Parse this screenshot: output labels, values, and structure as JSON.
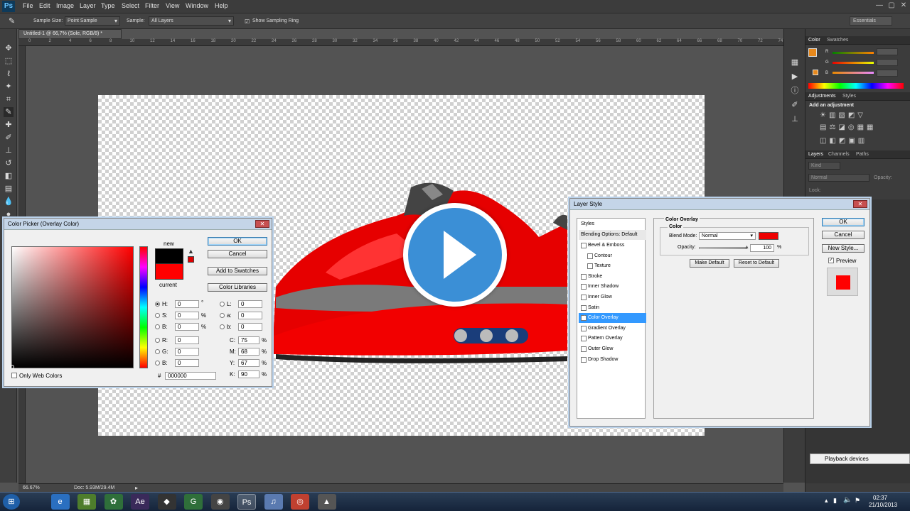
{
  "app": {
    "logo": "Ps",
    "accent": "#3b8fd6"
  },
  "menu": [
    "File",
    "Edit",
    "Image",
    "Layer",
    "Type",
    "Select",
    "Filter",
    "View",
    "Window",
    "Help"
  ],
  "window_controls": [
    "—",
    "▢",
    "✕"
  ],
  "options": {
    "sample_size_label": "Sample Size:",
    "sample_size_value": "Point Sample",
    "sample_label": "Sample:",
    "sample_value": "All Layers",
    "show_ring_label": "Show Sampling Ring",
    "workspace": "Essentials"
  },
  "document": {
    "tab_title": "Untitled-1 @ 66,7% (Sole, RGB/8) *",
    "zoom": "66.67%",
    "doc_size": "Doc: 5.93M/29.4M",
    "ruler_marks": [
      "0",
      "2",
      "4",
      "6",
      "8",
      "10",
      "12",
      "14",
      "16",
      "18",
      "20",
      "22",
      "24",
      "26",
      "28",
      "30",
      "32",
      "34",
      "36",
      "38",
      "40",
      "42",
      "44",
      "46",
      "48",
      "50",
      "52",
      "54",
      "56",
      "58",
      "60",
      "62",
      "64",
      "66",
      "68",
      "70",
      "72",
      "74"
    ]
  },
  "color_picker": {
    "title": "Color Picker (Overlay Color)",
    "new_label": "new",
    "current_label": "current",
    "new_color": "#000000",
    "current_color": "#ff0000",
    "ok": "OK",
    "cancel": "Cancel",
    "add_swatches": "Add to Swatches",
    "color_libraries": "Color Libraries",
    "only_web": "Only Web Colors",
    "fields": {
      "H": "0",
      "S": "0",
      "B": "0",
      "R": "0",
      "G": "0",
      "Bv": "0",
      "L": "0",
      "a": "0",
      "b": "0",
      "C": "75",
      "M": "68",
      "Y": "67",
      "K": "90",
      "hex": "000000"
    },
    "labels": {
      "H": "H:",
      "S": "S:",
      "B": "B:",
      "R": "R:",
      "G": "G:",
      "Bv": "B:",
      "L": "L:",
      "a": "a:",
      "b": "b:",
      "C": "C:",
      "M": "M:",
      "Y": "Y:",
      "K": "K:",
      "hex": "#",
      "deg": "°",
      "pct": "%"
    }
  },
  "layer_style": {
    "title": "Layer Style",
    "styles_header": "Styles",
    "blending": "Blending Options: Default",
    "items": [
      {
        "label": "Bevel & Emboss",
        "checked": false,
        "indent": false
      },
      {
        "label": "Contour",
        "checked": false,
        "indent": true
      },
      {
        "label": "Texture",
        "checked": false,
        "indent": true
      },
      {
        "label": "Stroke",
        "checked": false,
        "indent": false
      },
      {
        "label": "Inner Shadow",
        "checked": false,
        "indent": false
      },
      {
        "label": "Inner Glow",
        "checked": false,
        "indent": false
      },
      {
        "label": "Satin",
        "checked": false,
        "indent": false
      },
      {
        "label": "Color Overlay",
        "checked": true,
        "indent": false
      },
      {
        "label": "Gradient Overlay",
        "checked": false,
        "indent": false
      },
      {
        "label": "Pattern Overlay",
        "checked": false,
        "indent": false
      },
      {
        "label": "Outer Glow",
        "checked": false,
        "indent": false
      },
      {
        "label": "Drop Shadow",
        "checked": false,
        "indent": false
      }
    ],
    "section_title": "Color Overlay",
    "group_title": "Color",
    "blend_label": "Blend Mode:",
    "blend_value": "Normal",
    "overlay_color": "#ee0000",
    "opacity_label": "Opacity:",
    "opacity_value": "100",
    "opacity_unit": "%",
    "make_default": "Make Default",
    "reset_default": "Reset to Default",
    "ok": "OK",
    "cancel": "Cancel",
    "new_style": "New Style...",
    "preview_label": "Preview",
    "preview_color": "#ff0000"
  },
  "panels": {
    "color_tabs": [
      "Color",
      "Swatches"
    ],
    "adjust_tabs": [
      "Adjustments",
      "Styles"
    ],
    "add_adjustment": "Add an adjustment",
    "layers_tabs": [
      "Layers",
      "Channels",
      "Paths"
    ],
    "kind": "Kind",
    "blend": "Normal",
    "opacity": "Opacity:",
    "lock": "Lock:",
    "fg_color": "#e8891c",
    "color_labels": [
      "R",
      "G",
      "B"
    ]
  },
  "taskbar": {
    "playback": "Playback devices",
    "time": "02:37",
    "date": "21/10/2013",
    "apps": [
      "⊞",
      "e",
      "▦",
      "✿",
      "Ae",
      "◆",
      "G",
      "◉",
      "Ps",
      "♫",
      "◎",
      "▲"
    ]
  }
}
